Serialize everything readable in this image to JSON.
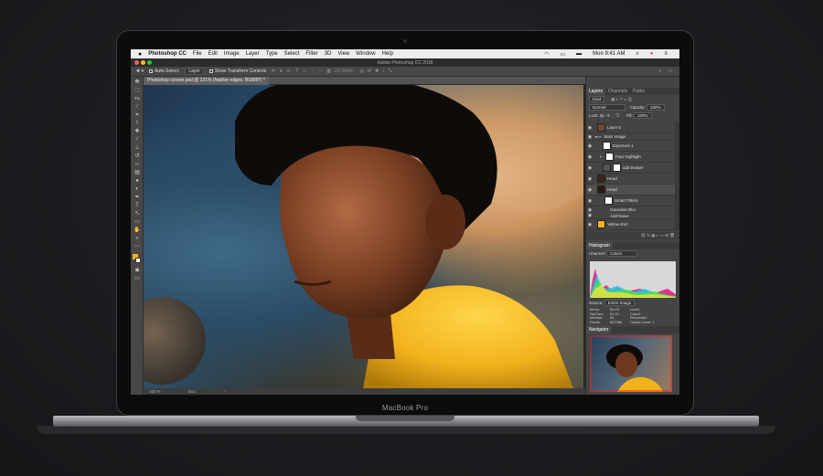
{
  "menubar": {
    "apple_icon": "apple-logo",
    "app_name": "Photoshop CC",
    "items": [
      "File",
      "Edit",
      "Image",
      "Layer",
      "Type",
      "Select",
      "Filter",
      "3D",
      "View",
      "Window",
      "Help"
    ],
    "clock": "Mon 9:41 AM"
  },
  "window": {
    "title": "Adobe Photoshop CC 2018"
  },
  "options": {
    "auto_select": "Auto-Select:",
    "auto_select_value": "Layer",
    "show_transform": "Show Transform Controls",
    "mode_3d": "3D Mode:"
  },
  "document": {
    "tab": "Photoshop screen.psd @ 121% (feather edges, RGB/8*) *"
  },
  "status": {
    "zoom": "100 %",
    "doc": "Doc:"
  },
  "layers_panel": {
    "tabs": [
      "Layers",
      "Channels",
      "Paths"
    ],
    "kind": "Kind",
    "blend_mode": "Normal",
    "opacity_label": "Opacity:",
    "opacity": "100%",
    "lock_label": "Lock:",
    "fill_label": "Fill:",
    "fill": "100%",
    "layers": [
      {
        "name": "Layer 0"
      },
      {
        "name": "Main Image"
      },
      {
        "name": "Exposure 1"
      },
      {
        "name": "Face highlight"
      },
      {
        "name": "add texture"
      },
      {
        "name": "Head"
      },
      {
        "name": "Head"
      },
      {
        "name": "Smart Filters"
      },
      {
        "name": "Gaussian Blur"
      },
      {
        "name": "Add Noise"
      },
      {
        "name": "Yellow shirt"
      }
    ]
  },
  "histogram_panel": {
    "title": "Histogram",
    "channel_label": "Channel:",
    "channel": "Colors",
    "source_label": "Source:",
    "source": "Entire Image",
    "stats": [
      {
        "label": "Mean:",
        "value": "94.03"
      },
      {
        "label": "Std Dev:",
        "value": "61.01"
      },
      {
        "label": "Median:",
        "value": "81"
      },
      {
        "label": "Pixels:",
        "value": "807456"
      }
    ],
    "stats_right": [
      "Level:",
      "Count:",
      "Percentile:",
      "Cache Level: 1"
    ]
  },
  "navigator_panel": {
    "title": "Navigator"
  },
  "laptop": {
    "brand": "MacBook Pro"
  },
  "colors": {
    "accent": "#ffb21c",
    "shirt": "#f2b21c",
    "panel": "#444444",
    "menubar": "#ececec"
  }
}
